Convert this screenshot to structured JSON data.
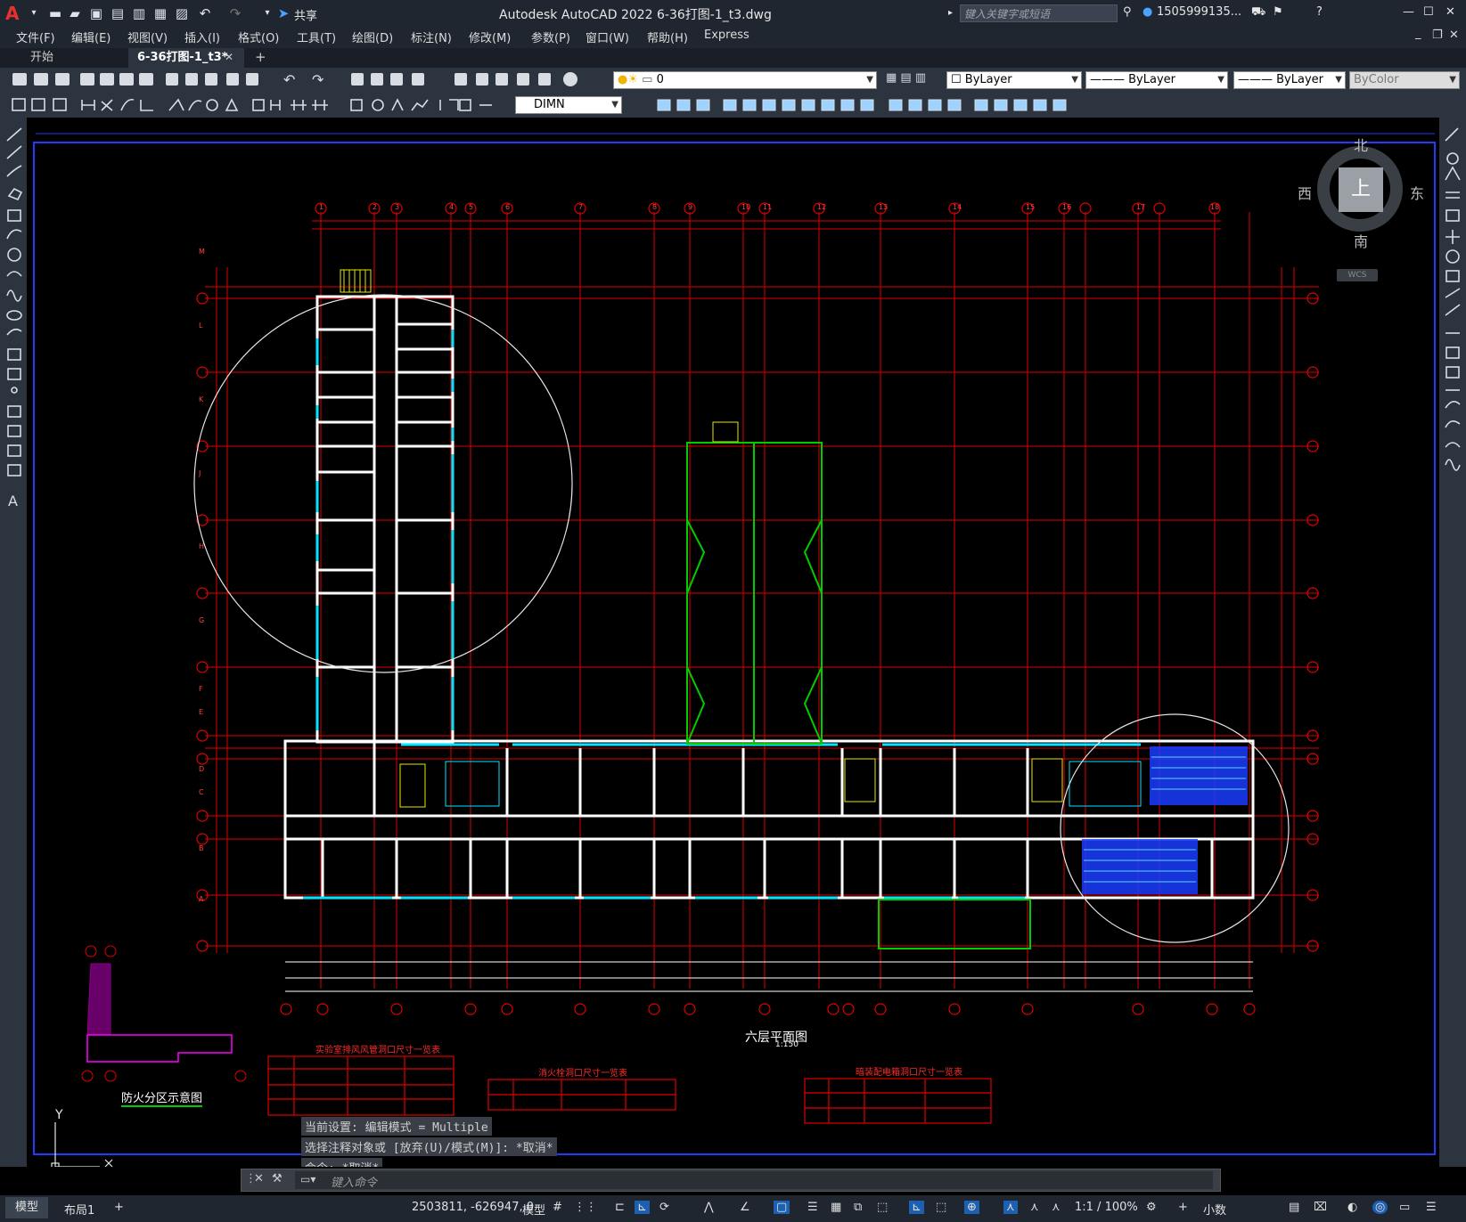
{
  "app": {
    "logo": "A",
    "title": "Autodesk AutoCAD 2022    6-36打图-1_t3.dwg",
    "share_label": "共享",
    "search_placeholder": "键入关键字或短语",
    "user": "1505999135...",
    "accent_color": "#e8312f"
  },
  "menu": [
    "文件(F)",
    "编辑(E)",
    "视图(V)",
    "插入(I)",
    "格式(O)",
    "工具(T)",
    "绘图(D)",
    "标注(N)",
    "修改(M)",
    "参数(P)",
    "窗口(W)",
    "帮助(H)",
    "Express"
  ],
  "tabs": {
    "start": "开始",
    "active": "6-36打图-1_t3*"
  },
  "toolbar": {
    "layer_value": "0",
    "color_value": "ByLayer",
    "linetype_value": "ByLayer",
    "lineweight_value": "ByLayer",
    "plotstyle_value": "ByColor",
    "dimstyle_value": "DIMN"
  },
  "viewcube": {
    "north": "北",
    "south": "南",
    "east": "东",
    "west": "西",
    "top": "上",
    "wcs": "WCS"
  },
  "drawing": {
    "title": "六层平面图",
    "scale": "1:150",
    "fire_zone_title": "防火分区示意图",
    "table1_title": "实验室排风风管洞口尺寸一览表",
    "table2_title": "消火栓洞口尺寸一览表",
    "table3_title": "暗装配电箱洞口尺寸一览表",
    "axes_top": [
      "1",
      "2",
      "3",
      "4",
      "5",
      "6",
      "7",
      "8",
      "9",
      "10",
      "11",
      "12",
      "13",
      "14",
      "15",
      "16",
      "17",
      "18"
    ],
    "axes_side": [
      "A",
      "B",
      "C",
      "D",
      "E",
      "F",
      "G",
      "H",
      "J",
      "K",
      "L",
      "M"
    ],
    "ucs_y": "Y"
  },
  "command": {
    "history": [
      "当前设置: 编辑模式 = Multiple",
      "选择注释对象或 [放弃(U)/模式(M)]: *取消*",
      "命令: *取消*"
    ],
    "placeholder": "键入命令"
  },
  "status": {
    "tab_model": "模型",
    "tab_layout": "布局1",
    "coords": "2503811, -626947, 0",
    "space": "模型",
    "scale": "1:1 / 100%",
    "units": "小数"
  }
}
